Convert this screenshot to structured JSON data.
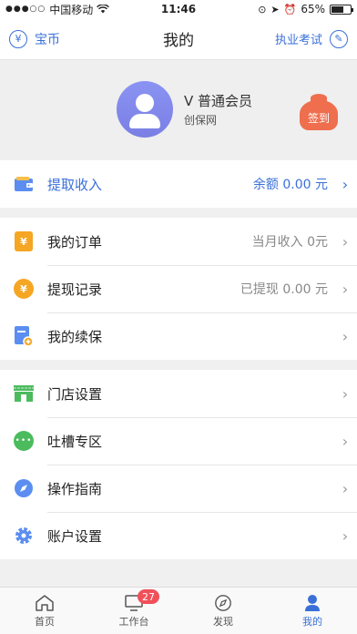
{
  "status_bar": {
    "carrier": "中国移动",
    "time": "11:46",
    "battery": "65%",
    "battery_level": 0.65
  },
  "nav": {
    "left_label": "宝币",
    "title": "我的",
    "right_label": "执业考试",
    "accent_color": "#3a6fd8"
  },
  "profile": {
    "level": "V 普通会员",
    "site": "创保网",
    "signin_label": "签到"
  },
  "withdraw": {
    "label": "提取收入",
    "balance": "余额 0.00 元"
  },
  "orders_section": {
    "items": [
      {
        "label": "我的订单",
        "value": "当月收入 0元",
        "icon": "order-icon"
      },
      {
        "label": "提现记录",
        "value": "已提现 0.00 元",
        "icon": "coin-icon"
      },
      {
        "label": "我的续保",
        "value": "",
        "icon": "renewal-icon"
      }
    ]
  },
  "settings_section": {
    "items": [
      {
        "label": "门店设置",
        "icon": "store-icon"
      },
      {
        "label": "吐槽专区",
        "icon": "chat-icon"
      },
      {
        "label": "操作指南",
        "icon": "compass-icon"
      },
      {
        "label": "账户设置",
        "icon": "gear-icon"
      }
    ]
  },
  "tabbar": {
    "tabs": [
      {
        "label": "首页",
        "icon": "home-icon"
      },
      {
        "label": "工作台",
        "icon": "monitor-icon",
        "badge": "27"
      },
      {
        "label": "发现",
        "icon": "compass-icon"
      },
      {
        "label": "我的",
        "icon": "person-icon",
        "active": true
      }
    ]
  }
}
